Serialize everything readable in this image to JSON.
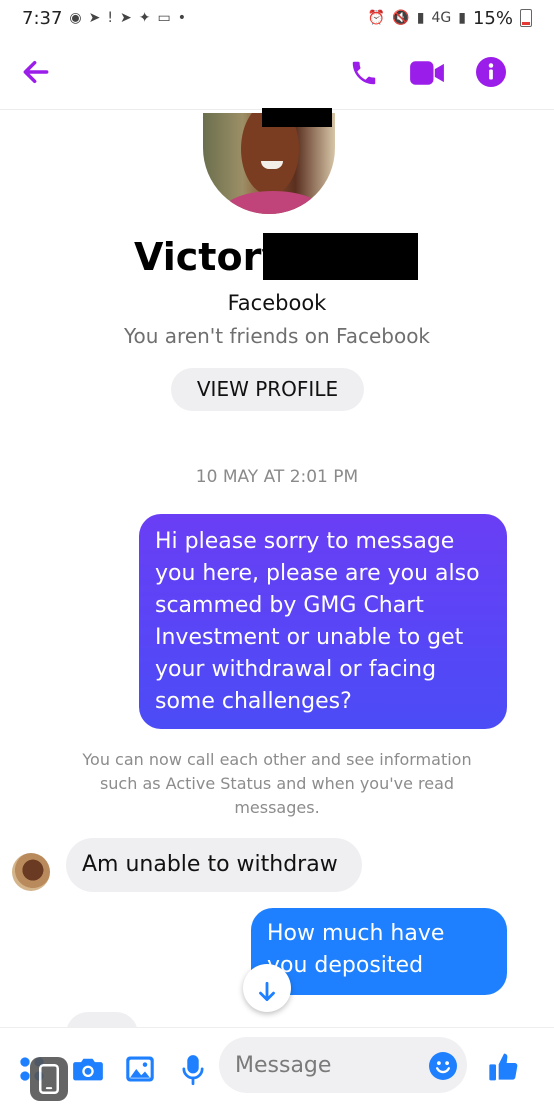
{
  "status_bar": {
    "time": "7:37",
    "network": "4G",
    "battery": "15%"
  },
  "header": {
    "accent_color": "#9b1dea",
    "icons": [
      "back-arrow-icon",
      "phone-call-icon",
      "video-camera-icon",
      "info-icon"
    ]
  },
  "profile": {
    "name": "Victory",
    "platform": "Facebook",
    "friendship_status": "You aren't friends on Facebook",
    "view_profile_label": "VIEW PROFILE"
  },
  "conversation": {
    "timestamp": "10 MAY AT 2:01 PM",
    "sent_message_1": "Hi please sorry to message you here, please are you also scammed by GMG Chart Investment or unable to get your withdrawal or facing some challenges?",
    "system_note": "You can now call each other and see information such as Active Status and when you've read messages.",
    "received_message_1": "Am unable to withdraw",
    "sent_message_2": "How much have you deposited"
  },
  "composer": {
    "placeholder": "Message",
    "icons": [
      "apps-icon",
      "camera-icon",
      "gallery-icon",
      "microphone-icon",
      "emoji-icon",
      "thumbs-up-icon"
    ],
    "accent_color": "#1e80ff"
  }
}
